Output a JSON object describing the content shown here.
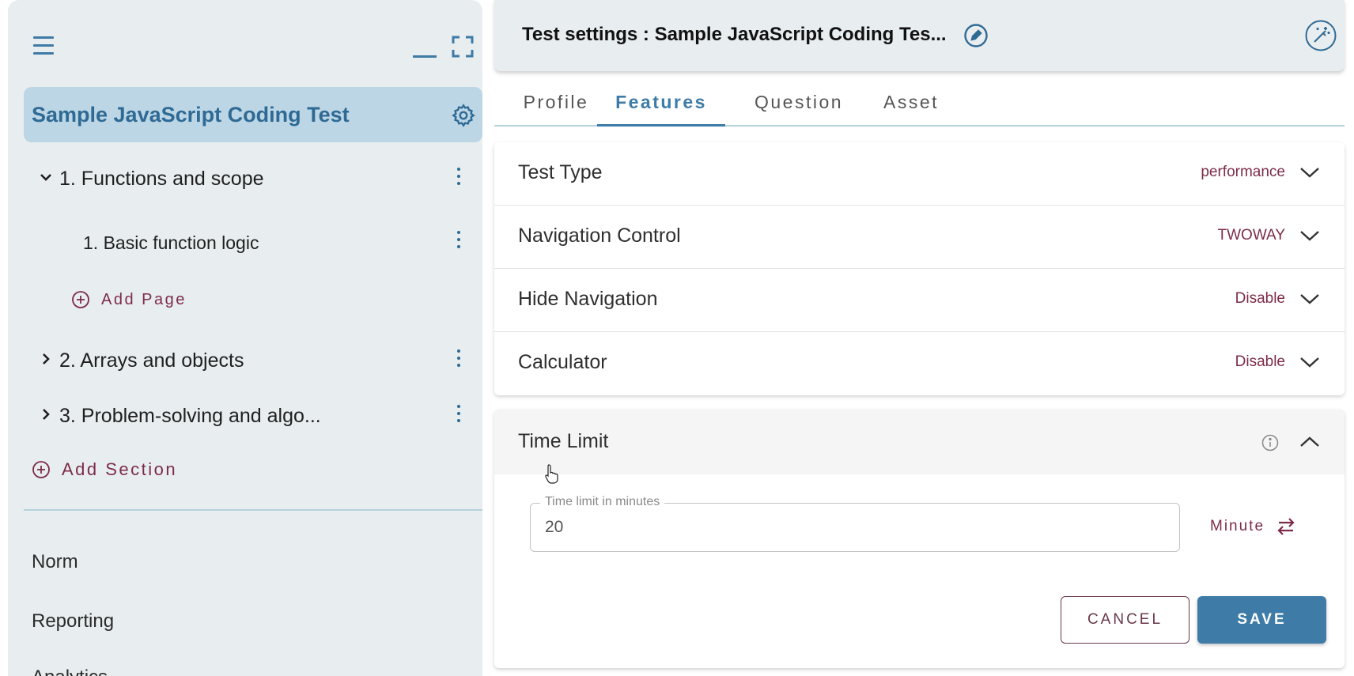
{
  "sidebar": {
    "test_title": "Sample JavaScript Coding Test",
    "sections": [
      {
        "label": "1. Functions and scope",
        "expanded": true
      },
      {
        "label": "2. Arrays and objects",
        "expanded": false
      },
      {
        "label": "3. Problem-solving and algo...",
        "expanded": false
      }
    ],
    "pages": [
      {
        "label": "1.  Basic function logic"
      }
    ],
    "add_page_label": "Add Page",
    "add_section_label": "Add Section",
    "nav": [
      {
        "label": "Norm"
      },
      {
        "label": "Reporting"
      },
      {
        "label": "Analytics"
      }
    ]
  },
  "header": {
    "title": "Test settings : Sample JavaScript Coding Tes..."
  },
  "tabs": [
    {
      "label": "Profile",
      "active": false
    },
    {
      "label": "Features",
      "active": true
    },
    {
      "label": "Question",
      "active": false
    },
    {
      "label": "Asset",
      "active": false
    }
  ],
  "features": [
    {
      "label": "Test Type",
      "value": "performance"
    },
    {
      "label": "Navigation Control",
      "value": "TWOWAY"
    },
    {
      "label": "Hide Navigation",
      "value": "Disable"
    },
    {
      "label": "Calculator",
      "value": "Disable"
    }
  ],
  "time_limit": {
    "label": "Time Limit",
    "field_label": "Time limit in minutes",
    "value": "20",
    "unit": "Minute",
    "cancel_label": "CANCEL",
    "save_label": "SAVE"
  },
  "colors": {
    "accent": "#3e7ba6",
    "secondary": "#7d2c48",
    "sidebar_bg": "#e8edf0",
    "selected_bg": "#bcd6e5"
  }
}
